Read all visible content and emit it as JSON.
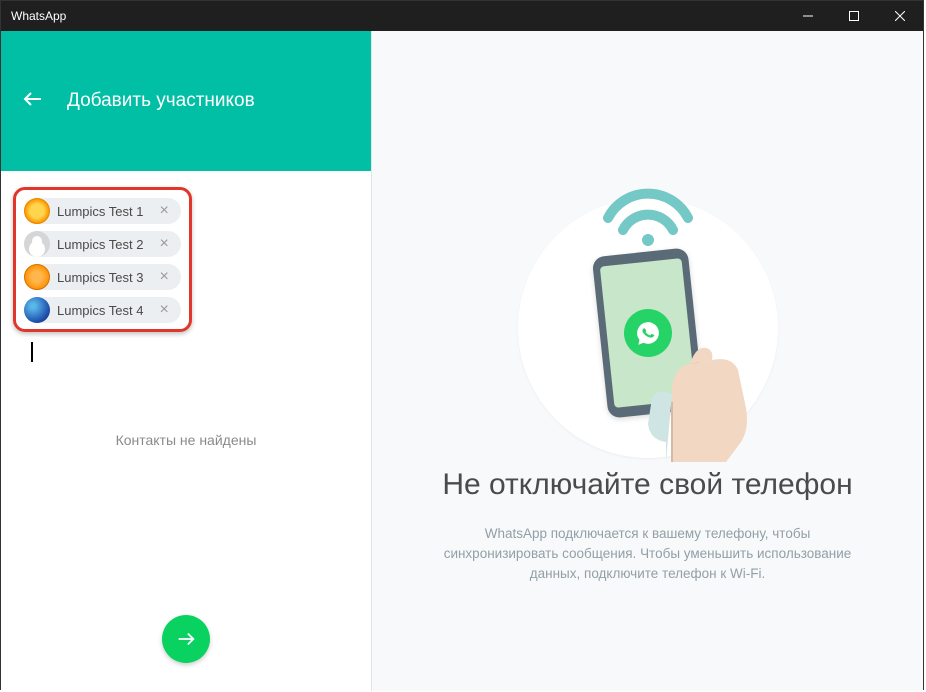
{
  "window": {
    "title": "WhatsApp"
  },
  "left": {
    "header_title": "Добавить участников",
    "chips": [
      {
        "name": "Lumpics Test 1",
        "avatar": "yellow"
      },
      {
        "name": "Lumpics Test 2",
        "avatar": "grey"
      },
      {
        "name": "Lumpics Test 3",
        "avatar": "orange"
      },
      {
        "name": "Lumpics Test 4",
        "avatar": "blue"
      }
    ],
    "no_contacts": "Контакты не найдены"
  },
  "right": {
    "title": "Не отключайте свой телефон",
    "desc": "WhatsApp подключается к вашему телефону, чтобы синхронизировать сообщения. Чтобы уменьшить использование данных, подключите телефон к Wi-Fi."
  }
}
